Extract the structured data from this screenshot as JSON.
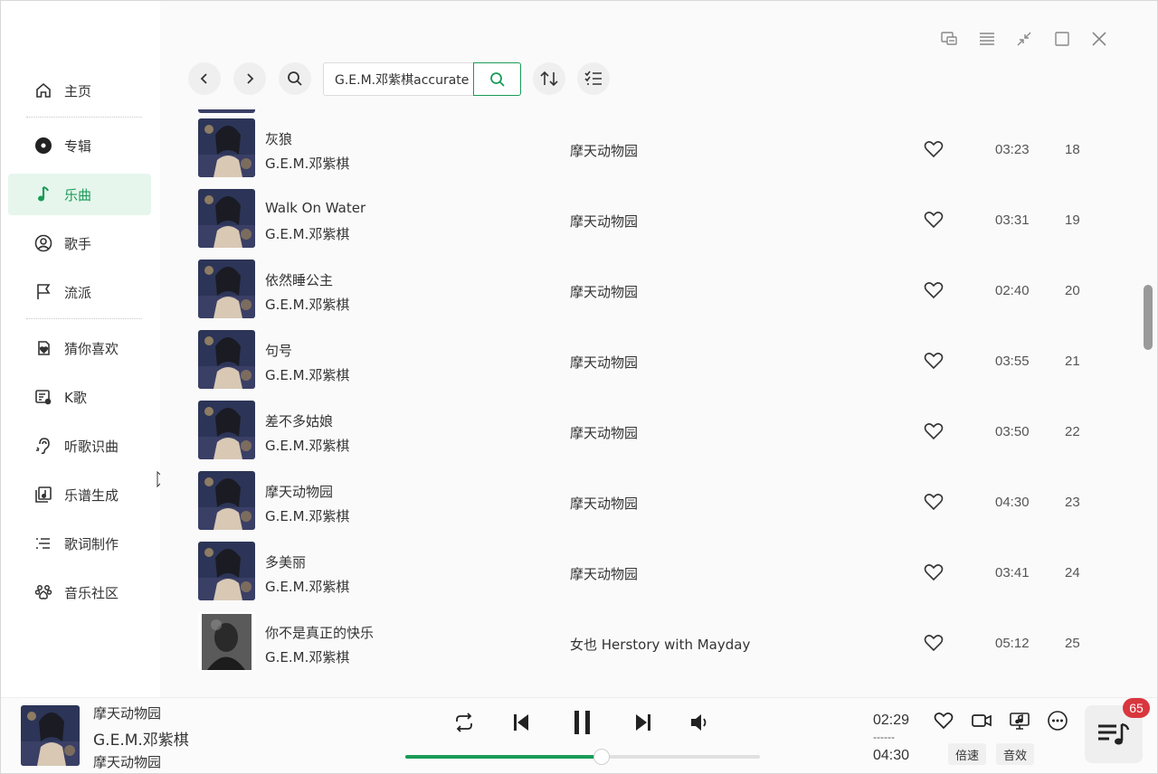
{
  "sidebar": {
    "items": [
      {
        "label": "主页",
        "icon": "home-icon"
      },
      {
        "label": "专辑",
        "icon": "album-disc-icon"
      },
      {
        "label": "乐曲",
        "icon": "music-note-icon",
        "active": true
      },
      {
        "label": "歌手",
        "icon": "singer-icon"
      },
      {
        "label": "流派",
        "icon": "flag-icon"
      },
      {
        "label": "猜你喜欢",
        "icon": "heart-doc-icon"
      },
      {
        "label": "K歌",
        "icon": "karaoke-icon"
      },
      {
        "label": "听歌识曲",
        "icon": "ear-icon"
      },
      {
        "label": "乐谱生成",
        "icon": "sheet-music-icon"
      },
      {
        "label": "歌词制作",
        "icon": "lyrics-icon"
      },
      {
        "label": "音乐社区",
        "icon": "community-icon"
      }
    ]
  },
  "toolbar": {
    "search_value": "G.E.M.邓紫棋accurate"
  },
  "songs": [
    {
      "title": "灰狼",
      "artist": "G.E.M.邓紫棋",
      "album": "摩天动物园",
      "duration": "03:23",
      "index": "18"
    },
    {
      "title": "Walk On Water",
      "artist": "G.E.M.邓紫棋",
      "album": "摩天动物园",
      "duration": "03:31",
      "index": "19"
    },
    {
      "title": "依然睡公主",
      "artist": "G.E.M.邓紫棋",
      "album": "摩天动物园",
      "duration": "02:40",
      "index": "20"
    },
    {
      "title": "句号",
      "artist": "G.E.M.邓紫棋",
      "album": "摩天动物园",
      "duration": "03:55",
      "index": "21"
    },
    {
      "title": "差不多姑娘",
      "artist": "G.E.M.邓紫棋",
      "album": "摩天动物园",
      "duration": "03:50",
      "index": "22"
    },
    {
      "title": "摩天动物园",
      "artist": "G.E.M.邓紫棋",
      "album": "摩天动物园",
      "duration": "04:30",
      "index": "23"
    },
    {
      "title": "多美丽",
      "artist": "G.E.M.邓紫棋",
      "album": "摩天动物园",
      "duration": "03:41",
      "index": "24"
    },
    {
      "title": "你不是真正的快乐",
      "artist": "G.E.M.邓紫棋",
      "album": "女也 Herstory with Mayday",
      "duration": "05:12",
      "index": "25",
      "gray_cover": true
    }
  ],
  "player": {
    "title": "摩天动物园",
    "artist": "G.E.M.邓紫棋",
    "album": "摩天动物园",
    "current_time": "02:29",
    "separator": "------",
    "total_time": "04:30",
    "progress": 0.553,
    "speed_label": "倍速",
    "effect_label": "音效",
    "queue_count": "65"
  },
  "colors": {
    "accent": "#1a9b57",
    "active_bg": "#e6f6ec",
    "badge": "#d9363e"
  }
}
